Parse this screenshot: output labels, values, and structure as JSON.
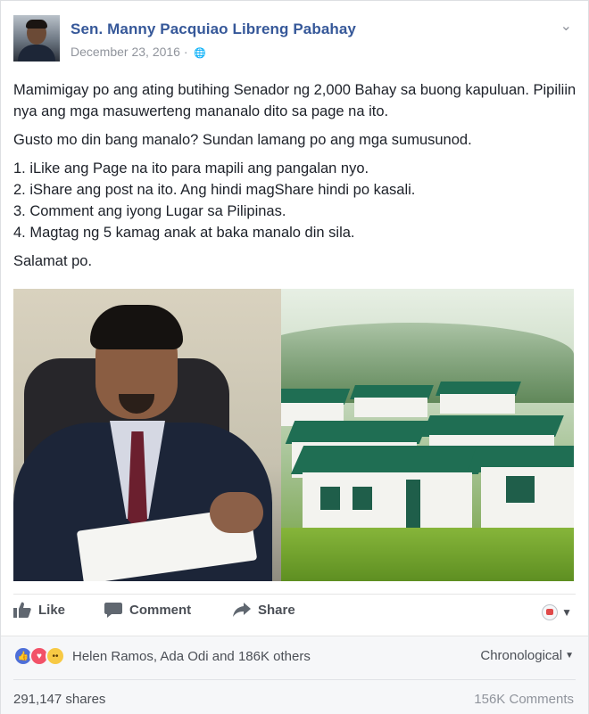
{
  "post": {
    "page_name": "Sen. Manny Pacquiao Libreng Pabahay",
    "date": "December 23, 2016",
    "date_separator": "·",
    "body": {
      "p1": "Mamimigay po ang ating butihing Senador ng 2,000 Bahay sa buong kapuluan. Pipiliin nya ang mga masuwerteng mananalo dito sa page na ito.",
      "p2": "Gusto mo din bang manalo? Sundan lamang po ang mga sumusunod.",
      "list": [
        "1. iLike ang Page na ito para mapili ang pangalan nyo.",
        "2. iShare ang post na ito. Ang hindi magShare hindi po kasali.",
        "3. Comment ang iyong Lugar sa Pilipinas.",
        "4. Magtag ng 5 kamag anak at baka manalo din sila."
      ],
      "p3": "Salamat po."
    }
  },
  "actions": {
    "like": "Like",
    "comment": "Comment",
    "share": "Share"
  },
  "footer": {
    "reactions_text": "Helen Ramos, Ada Odi and 186K others",
    "sort_label": "Chronological",
    "shares": "291,147 shares",
    "comments": "156K Comments"
  },
  "colors": {
    "link_blue": "#365899",
    "muted_gray": "#90949c",
    "text": "#1d2129",
    "action_gray": "#4b4f56",
    "like_blue": "#4e6fd8",
    "love_red": "#f25268",
    "wow_yellow": "#f7c944"
  },
  "icons": {
    "audience": "globe-icon",
    "menu": "chevron-down-icon",
    "like": "thumbs-up-icon",
    "comment": "speech-bubble-icon",
    "share": "share-arrow-icon"
  }
}
